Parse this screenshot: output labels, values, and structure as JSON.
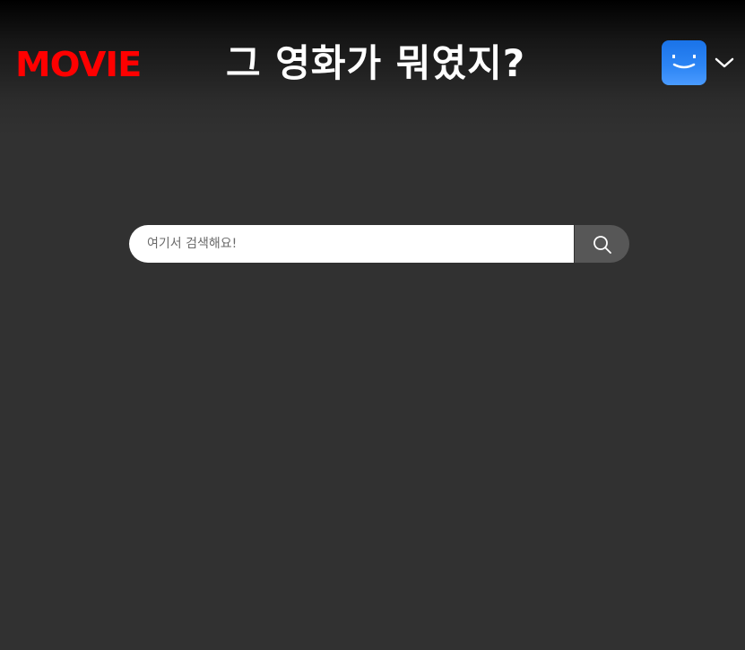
{
  "header": {
    "logo_text": "MOVIE",
    "title": "그 영화가 뭐였지?",
    "profile": {
      "avatar_icon": "smiley-face-icon",
      "dropdown_icon": "chevron-down-icon"
    }
  },
  "search": {
    "placeholder": "여기서 검색해요!",
    "value": "",
    "button_icon": "search-icon"
  },
  "colors": {
    "logo": "#ff0000",
    "background": "#313131",
    "header_top": "#000000",
    "avatar": "#1a73e8",
    "search_button": "#575757"
  }
}
